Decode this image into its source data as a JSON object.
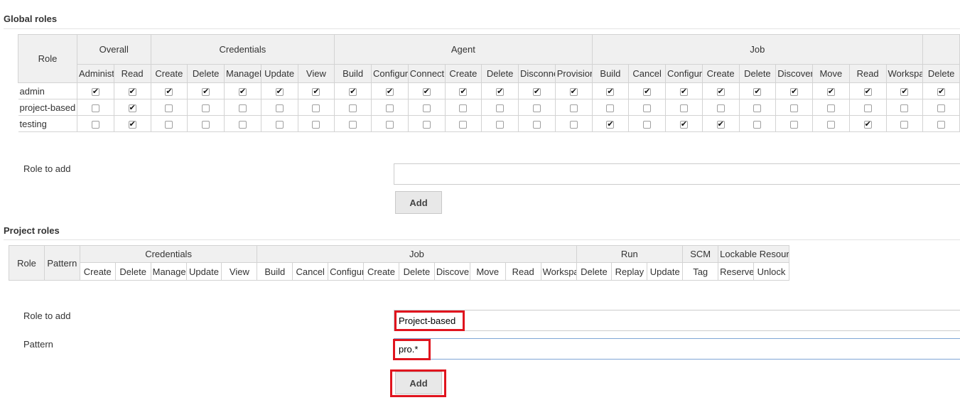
{
  "global_roles": {
    "title": "Global roles",
    "role_header": "Role",
    "groups": [
      {
        "label": "Overall",
        "perms": [
          "Administer",
          "Read"
        ]
      },
      {
        "label": "Credentials",
        "perms": [
          "Create",
          "Delete",
          "ManageDomains",
          "Update",
          "View"
        ]
      },
      {
        "label": "Agent",
        "perms": [
          "Build",
          "Configure",
          "Connect",
          "Create",
          "Delete",
          "Disconnect",
          "Provision"
        ]
      },
      {
        "label": "Job",
        "perms": [
          "Build",
          "Cancel",
          "Configure",
          "Create",
          "Delete",
          "Discover",
          "Move",
          "Read",
          "Workspace"
        ]
      },
      {
        "label": "",
        "perms": [
          "Delete"
        ]
      }
    ],
    "rows": [
      {
        "name": "admin",
        "checks": [
          1,
          1,
          1,
          1,
          1,
          1,
          1,
          1,
          1,
          1,
          1,
          1,
          1,
          1,
          1,
          1,
          1,
          1,
          1,
          1,
          1,
          1,
          1,
          1
        ]
      },
      {
        "name": "project-based",
        "checks": [
          0,
          1,
          0,
          0,
          0,
          0,
          0,
          0,
          0,
          0,
          0,
          0,
          0,
          0,
          0,
          0,
          0,
          0,
          0,
          0,
          0,
          0,
          0,
          0
        ]
      },
      {
        "name": "testing",
        "checks": [
          0,
          1,
          0,
          0,
          0,
          0,
          0,
          0,
          0,
          0,
          0,
          0,
          0,
          0,
          1,
          0,
          1,
          1,
          0,
          0,
          0,
          1,
          0,
          0
        ]
      }
    ],
    "role_to_add_label": "Role to add",
    "role_to_add_value": "",
    "add_label": "Add"
  },
  "project_roles": {
    "title": "Project roles",
    "role_header": "Role",
    "pattern_header": "Pattern",
    "groups": [
      {
        "label": "Credentials",
        "perms": [
          "Create",
          "Delete",
          "ManageDomains",
          "Update",
          "View"
        ]
      },
      {
        "label": "Job",
        "perms": [
          "Build",
          "Cancel",
          "Configure",
          "Create",
          "Delete",
          "Discover",
          "Move",
          "Read",
          "Workspace"
        ]
      },
      {
        "label": "Run",
        "perms": [
          "Delete",
          "Replay",
          "Update"
        ]
      },
      {
        "label": "SCM",
        "perms": [
          "Tag"
        ]
      },
      {
        "label": "Lockable Resources",
        "perms": [
          "Reserve",
          "Unlock"
        ]
      }
    ],
    "role_to_add_label": "Role to add",
    "role_to_add_value": "Project-based",
    "pattern_label": "Pattern",
    "pattern_value": "pro.*",
    "add_label": "Add"
  },
  "colors": {
    "highlight": "#e0141e",
    "header_bg": "#f0f0f0",
    "delete_icon": "#d9534f"
  }
}
